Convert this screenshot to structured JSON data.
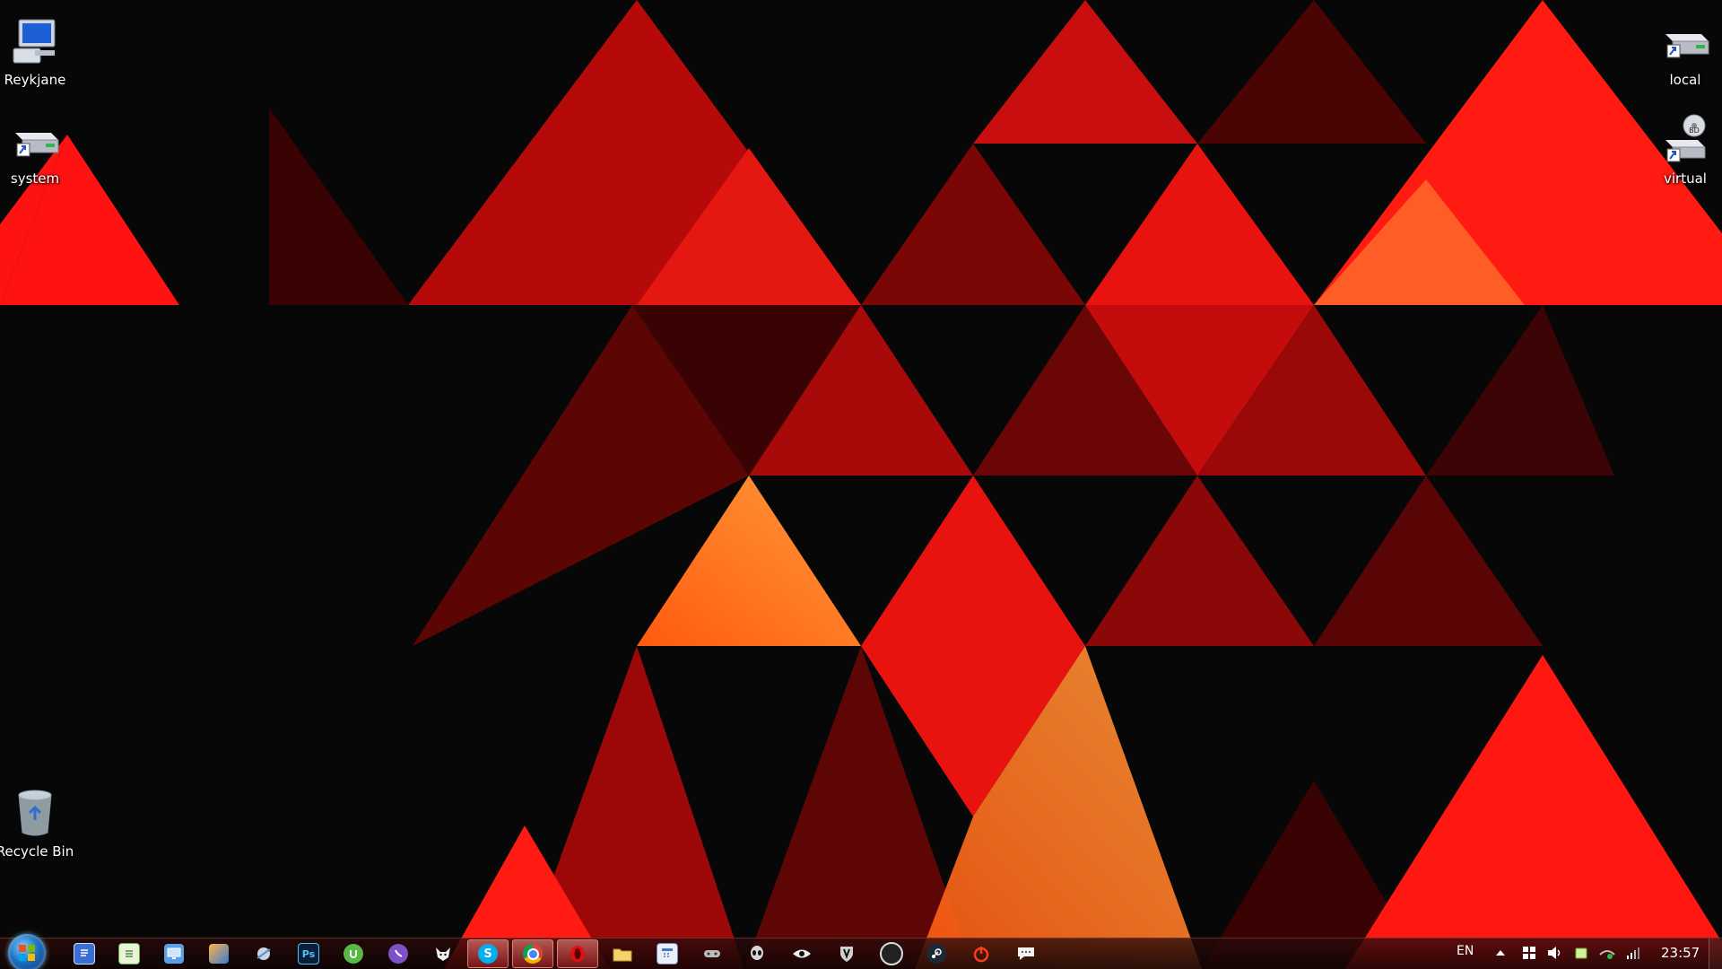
{
  "desktop": {
    "icons": [
      {
        "label": "Reykjane",
        "icon": "computer-icon"
      },
      {
        "label": "system",
        "icon": "hard-drive-shortcut-icon"
      },
      {
        "label": "Recycle Bin",
        "icon": "recycle-bin-icon"
      },
      {
        "label": "local",
        "icon": "hard-drive-shortcut-icon"
      },
      {
        "label": "virtual",
        "icon": "bd-drive-shortcut-icon"
      }
    ]
  },
  "taskbar": {
    "pinned": [
      {
        "icon": "wordpad-icon"
      },
      {
        "icon": "notepad-icon"
      },
      {
        "icon": "remote-desktop-icon"
      },
      {
        "icon": "media-center-icon"
      },
      {
        "icon": "satellite-icon"
      },
      {
        "icon": "photoshop-icon",
        "glyph": "Ps"
      },
      {
        "icon": "utorrent-icon"
      },
      {
        "icon": "viber-icon"
      },
      {
        "icon": "fox-icon"
      },
      {
        "icon": "skype-icon",
        "glyph": "S"
      },
      {
        "icon": "chrome-icon"
      },
      {
        "icon": "opera-icon"
      },
      {
        "icon": "explorer-folder-icon"
      },
      {
        "icon": "calendar-icon"
      },
      {
        "icon": "gamepad-icon"
      },
      {
        "icon": "alien-icon"
      },
      {
        "icon": "eye-icon"
      },
      {
        "icon": "shield-game-icon"
      },
      {
        "icon": "logitech-icon"
      },
      {
        "icon": "steam-icon"
      },
      {
        "icon": "power-icon"
      },
      {
        "icon": "chat-bubble-icon"
      }
    ],
    "tray": {
      "language": "EN",
      "icons": [
        "show-hidden-icons-icon",
        "windows-flag-icon",
        "volume-icon",
        "battery-icon",
        "network-icon",
        "signal-bars-icon"
      ],
      "time": "23:57"
    }
  },
  "colors": {
    "bright_red": "#ff1010",
    "red": "#c40a0a",
    "dark_red": "#6a0606",
    "orange": "#ff7a1a",
    "background": "#070707"
  }
}
